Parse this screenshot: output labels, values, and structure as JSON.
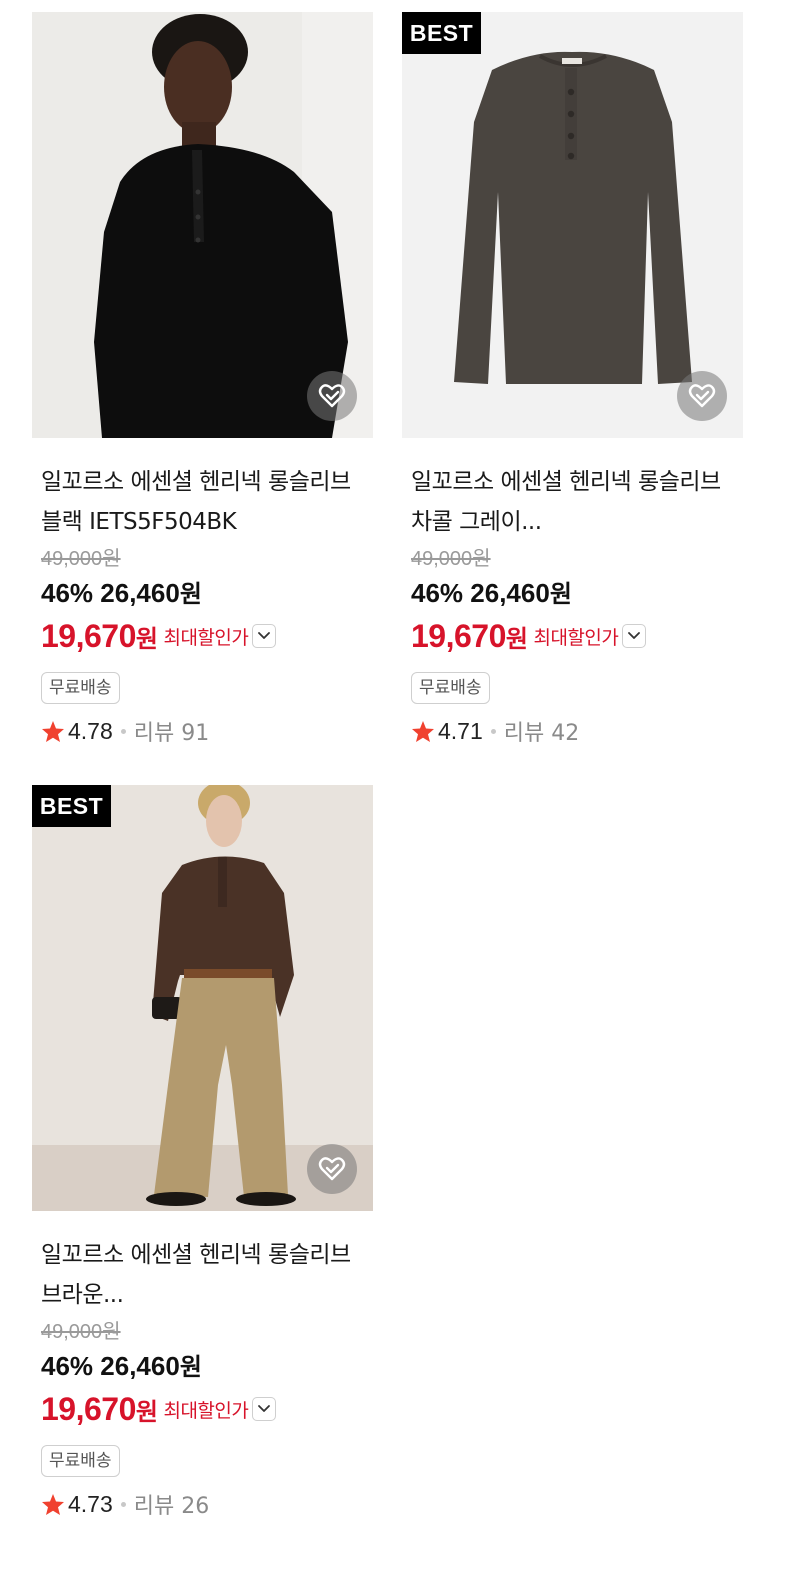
{
  "products": [
    {
      "badge": "",
      "title": "일꼬르소 에센셜 헨리넥 롱슬리브 블랙 IETS5F504BK",
      "original_price": "49,000원",
      "discount_rate": "46%",
      "sale_price": "26,460",
      "sale_unit": "원",
      "max_price": "19,670",
      "max_unit": "원",
      "max_label": "최대할인가",
      "shipping_tag": "무료배송",
      "rating": "4.78",
      "review_label": "리뷰 91"
    },
    {
      "badge": "BEST",
      "title": "일꼬르소 에센셜 헨리넥 롱슬리브 차콜 그레이...",
      "original_price": "49,000원",
      "discount_rate": "46%",
      "sale_price": "26,460",
      "sale_unit": "원",
      "max_price": "19,670",
      "max_unit": "원",
      "max_label": "최대할인가",
      "shipping_tag": "무료배송",
      "rating": "4.71",
      "review_label": "리뷰 42"
    },
    {
      "badge": "BEST",
      "title": "일꼬르소 에센셜 헨리넥 롱슬리브 브라운...",
      "original_price": "49,000원",
      "discount_rate": "46%",
      "sale_price": "26,460",
      "sale_unit": "원",
      "max_price": "19,670",
      "max_unit": "원",
      "max_label": "최대할인가",
      "shipping_tag": "무료배송",
      "rating": "4.73",
      "review_label": "리뷰 26"
    }
  ],
  "icons": {
    "wishlist": "heart-check-icon",
    "chevron": "chevron-down-icon",
    "star": "star-icon"
  },
  "colors": {
    "price_red": "#d7132a",
    "star_red": "#f0412f",
    "badge_bg": "#000000"
  }
}
